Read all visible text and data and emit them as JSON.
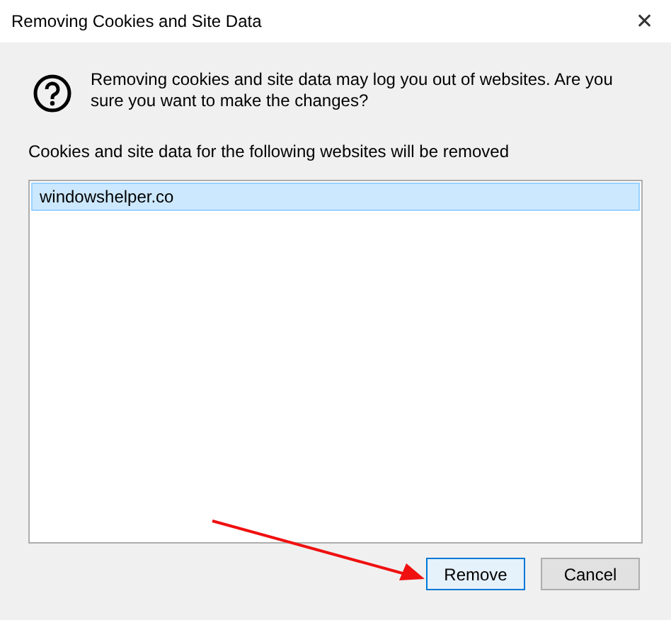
{
  "window": {
    "title": "Removing Cookies and Site Data",
    "close": "✕"
  },
  "message": "Removing cookies and site data may log you out of websites. Are you sure you want to make the changes?",
  "list_label": "Cookies and site data for the following websites will be removed",
  "sites": [
    {
      "label": "windowshelper.co",
      "selected": true
    }
  ],
  "buttons": [
    {
      "label": "Remove",
      "kind": "default"
    },
    {
      "label": "Cancel",
      "kind": "normal"
    }
  ]
}
